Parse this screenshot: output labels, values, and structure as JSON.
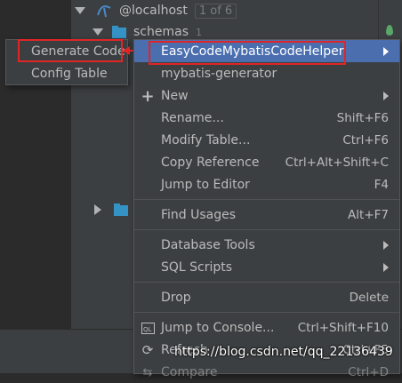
{
  "tree": {
    "host_label": "@localhost",
    "host_count": "1 of 6",
    "schemas_label": "schemas",
    "schemas_count": "1"
  },
  "submenu": {
    "items": [
      {
        "label": "Generate Code"
      },
      {
        "label": "Config Table"
      }
    ]
  },
  "context_menu": {
    "items": [
      {
        "label": "EasyCodeMybatisCodeHelper",
        "shortcut": "",
        "has_submenu": true,
        "selected": true
      },
      {
        "label": "mybatis-generator",
        "shortcut": ""
      },
      {
        "label": "New",
        "shortcut": "",
        "has_submenu": true,
        "icon": "plus-icon"
      },
      {
        "label": "Rename...",
        "shortcut": "Shift+F6"
      },
      {
        "label": "Modify Table...",
        "shortcut": "Ctrl+F6"
      },
      {
        "label": "Copy Reference",
        "shortcut": "Ctrl+Alt+Shift+C"
      },
      {
        "label": "Jump to Editor",
        "shortcut": "F4"
      },
      {
        "label": "Find Usages",
        "shortcut": "Alt+F7"
      },
      {
        "label": "Database Tools",
        "shortcut": "",
        "has_submenu": true
      },
      {
        "label": "SQL Scripts",
        "shortcut": "",
        "has_submenu": true
      },
      {
        "label": "Drop",
        "shortcut": "Delete"
      },
      {
        "label": "Jump to Console...",
        "shortcut": "Ctrl+Shift+F10",
        "icon": "console-icon"
      },
      {
        "label": "Refresh",
        "shortcut": "Ctrl+F5",
        "icon": "refresh-icon"
      },
      {
        "label": "Compare",
        "shortcut": "Ctrl+D",
        "icon": "compare-icon"
      }
    ]
  },
  "watermark": "https://blog.csdn.net/qq_22136439",
  "colors": {
    "selection": "#4b6eaf",
    "annotation_red": "#e02525",
    "menu_bg": "#3c3f41"
  }
}
